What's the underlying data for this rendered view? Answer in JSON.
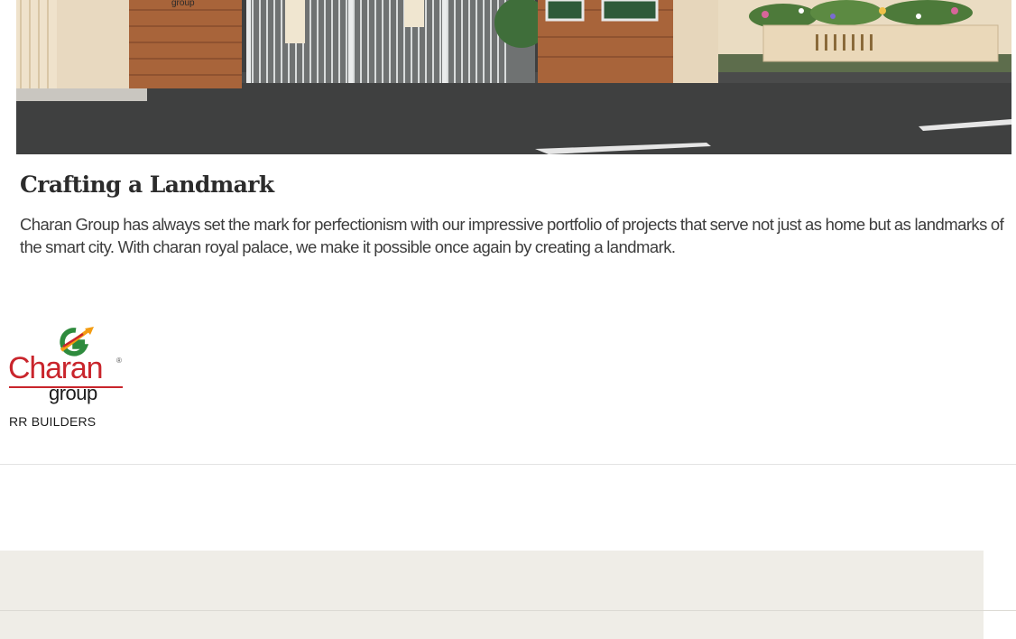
{
  "hero": {
    "sign_text": "group"
  },
  "section": {
    "title": "Crafting a Landmark",
    "body": "Charan Group has always set the mark for perfectionism with our impressive portfolio of projects that serve not just as home but as landmarks of the smart city. With charan royal palace, we make it possible once again by creating a landmark."
  },
  "logo": {
    "brand": "Charan",
    "registered": "®",
    "sub": "group",
    "tagline": "RR BUILDERS"
  },
  "colors": {
    "brand_red": "#c9252c",
    "brand_green": "#2e8b3d",
    "brand_orange": "#f39c12",
    "panel_beige": "#efede7",
    "road": "#3e3f3f"
  }
}
